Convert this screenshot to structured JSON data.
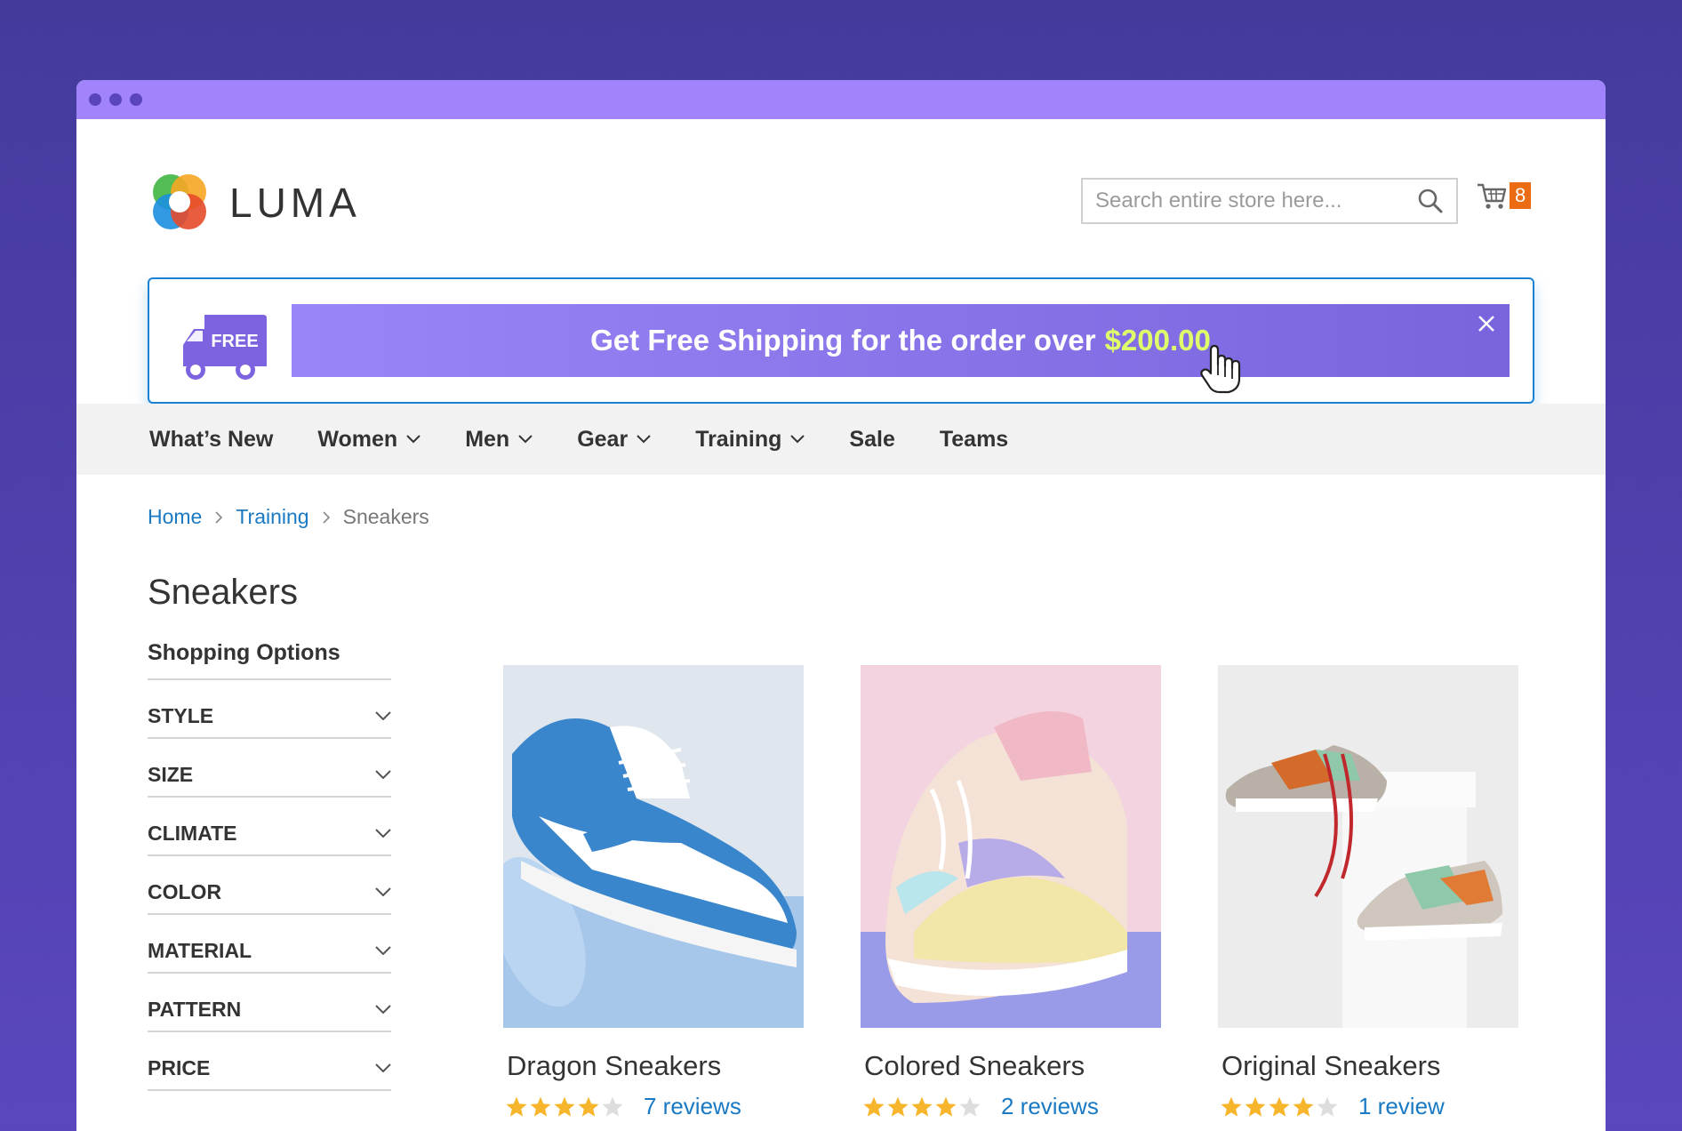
{
  "store": {
    "name": "LUMA"
  },
  "search": {
    "placeholder": "Search entire store here..."
  },
  "cart": {
    "count": "8"
  },
  "promo": {
    "badge": "FREE",
    "text": "Get Free Shipping for the order over",
    "amount": "$200.00"
  },
  "nav": {
    "items": [
      {
        "label": "What’s New",
        "has_dropdown": false
      },
      {
        "label": "Women",
        "has_dropdown": true
      },
      {
        "label": "Men",
        "has_dropdown": true
      },
      {
        "label": "Gear",
        "has_dropdown": true
      },
      {
        "label": "Training",
        "has_dropdown": true
      },
      {
        "label": "Sale",
        "has_dropdown": false
      },
      {
        "label": "Teams",
        "has_dropdown": false
      }
    ]
  },
  "breadcrumb": {
    "items": [
      "Home",
      "Training",
      "Sneakers"
    ]
  },
  "page": {
    "title": "Sneakers"
  },
  "sidebar": {
    "title": "Shopping Options",
    "filters": [
      "STYLE",
      "SIZE",
      "CLIMATE",
      "COLOR",
      "MATERIAL",
      "PATTERN",
      "PRICE"
    ]
  },
  "products": [
    {
      "name": "Dragon Sneakers",
      "rating": 4,
      "reviews": "7 reviews"
    },
    {
      "name": "Colored Sneakers",
      "rating": 4,
      "reviews": "2 reviews"
    },
    {
      "name": "Original Sneakers",
      "rating": 4,
      "reviews": "1 review"
    }
  ],
  "colors": {
    "background": "#443a9c",
    "titlebar": "#a184fb",
    "link": "#1979c3",
    "promo_accent": "#dfff6a",
    "cart_badge": "#ec6c14",
    "star": "#f6b52a"
  }
}
